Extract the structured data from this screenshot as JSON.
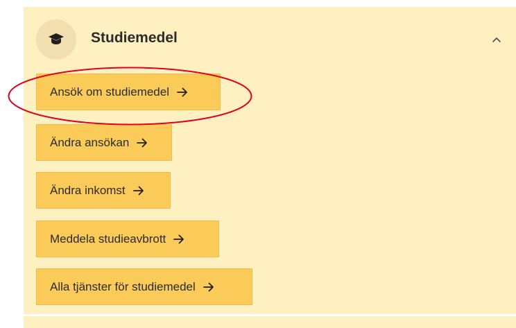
{
  "section": {
    "title": "Studiemedel",
    "icon": "graduation-cap-icon",
    "expanded_icon": "chevron-up-icon"
  },
  "buttons": [
    {
      "label": "Ansök om studiemedel",
      "icon": "arrow-right-icon"
    },
    {
      "label": "Ändra ansökan",
      "icon": "arrow-right-icon"
    },
    {
      "label": "Ändra inkomst",
      "icon": "arrow-right-icon"
    },
    {
      "label": "Meddela studieavbrott",
      "icon": "arrow-right-icon"
    },
    {
      "label": "Alla tjänster för studiemedel",
      "icon": "arrow-right-icon"
    }
  ],
  "colors": {
    "panel_background": "#fff0c2",
    "button_background": "#fbcb5a",
    "icon_circle": "#f2dfb0",
    "highlight_ellipse": "#e0001b",
    "text": "#2b2b2b"
  }
}
